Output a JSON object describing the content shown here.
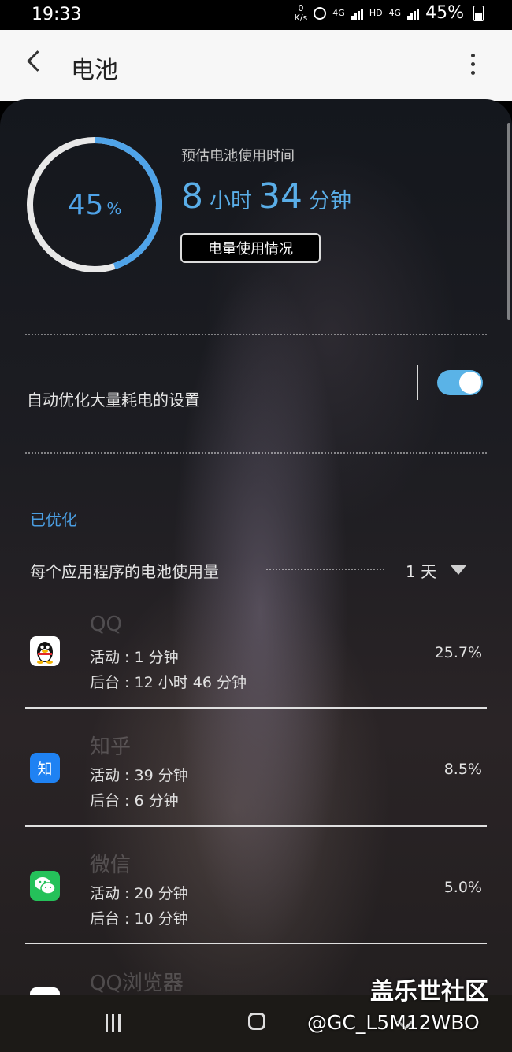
{
  "status_bar": {
    "time": "19:33",
    "net_speed_value": "0",
    "net_speed_unit": "K/s",
    "signal1": "4G",
    "signal2_prefix": "HD",
    "signal2": "4G",
    "battery": "45%"
  },
  "header": {
    "title": "电池"
  },
  "battery": {
    "percent_value": "45",
    "percent_unit": "%",
    "level": 0.45,
    "estimate_label": "预估电池使用时间",
    "hours": "8",
    "hours_unit": "小时",
    "minutes": "34",
    "minutes_unit": "分钟",
    "usage_button": "电量使用情况"
  },
  "optimize": {
    "subtitle": "自动优化大量耗电的设置",
    "enabled": true
  },
  "mode": {
    "value": "已优化"
  },
  "per_app": {
    "label": "每个应用程序的电池使用量",
    "period": "1 天"
  },
  "apps": [
    {
      "name": "QQ",
      "active": "活动 : 1 分钟",
      "background": "后台 : 12 小时 46 分钟",
      "percent": "25.7%"
    },
    {
      "name": "知乎",
      "icon_text": "知",
      "active": "活动 : 39 分钟",
      "background": "后台 : 6 分钟",
      "percent": "8.5%"
    },
    {
      "name": "微信",
      "active": "活动 : 20 分钟",
      "background": "后台 : 10 分钟",
      "percent": "5.0%"
    },
    {
      "name": "QQ浏览器"
    }
  ],
  "watermark": {
    "main": "盖乐世社区",
    "sub": "@GC_L5M12WBO"
  },
  "colors": {
    "accent": "#4fa3e8",
    "toggle": "#5ab3e7",
    "zhihu": "#1f82f3",
    "wechat": "#25c15a"
  }
}
